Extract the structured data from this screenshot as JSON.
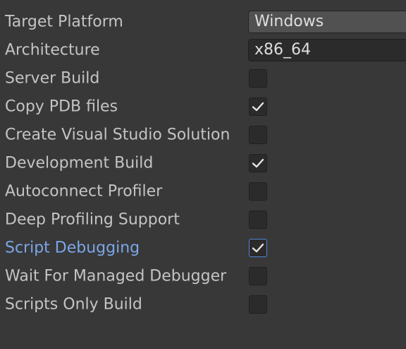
{
  "settings": {
    "target_platform": {
      "label": "Target Platform",
      "value": "Windows"
    },
    "architecture": {
      "label": "Architecture",
      "value": "x86_64"
    },
    "checkboxes": [
      {
        "label": "Server Build",
        "checked": false
      },
      {
        "label": "Copy PDB files",
        "checked": true
      },
      {
        "label": "Create Visual Studio Solution",
        "checked": false
      },
      {
        "label": "Development Build",
        "checked": true
      },
      {
        "label": "Autoconnect Profiler",
        "checked": false
      },
      {
        "label": "Deep Profiling Support",
        "checked": false
      },
      {
        "label": "Script Debugging",
        "checked": true,
        "highlighted": true
      },
      {
        "label": "Wait For Managed Debugger",
        "checked": false
      },
      {
        "label": "Scripts Only Build",
        "checked": false
      }
    ]
  },
  "icons": {
    "checkmark": "checkmark-icon"
  },
  "colors": {
    "background": "#383838",
    "label_text": "#c4c4c4",
    "highlight_label": "#7ba6e8",
    "focus_border": "#4f86d8"
  }
}
